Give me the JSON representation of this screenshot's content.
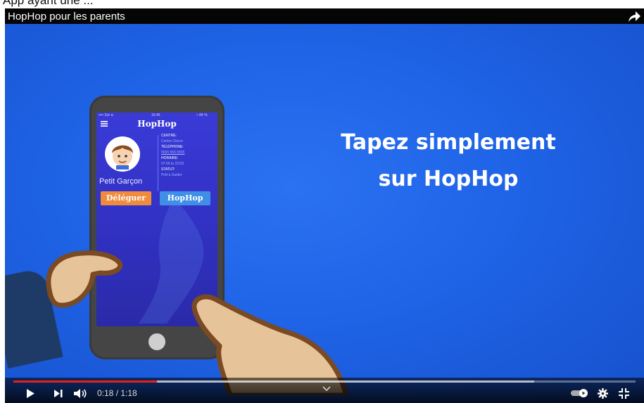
{
  "page": {
    "top_text": "App ayant une ..."
  },
  "player": {
    "title": "HopHop pour les parents",
    "colors": {
      "background": "#1f63e6",
      "progress": "#e62117",
      "title_bar": "#050505"
    }
  },
  "video": {
    "headline_line1": "Tapez simplement",
    "headline_line2": "sur HopHop",
    "phone": {
      "status_left": "•••• Sol ≋",
      "status_time": "15:45",
      "status_right": "≈ 84 %",
      "app_title": "HopHop",
      "centre_label": "CENTRE:",
      "centre_value": "Centre Clerco",
      "telephone_label": "TÉLÉPHONE:",
      "telephone_value": "5555 555 5555",
      "horaire_label": "HORAIRE:",
      "horaire_value": "07:00 to 23:59",
      "statut_label": "STATUT:",
      "statut_value": "Prêt à Guider",
      "child_name": "Petit Garçon",
      "deleguer_label": "Déléguer",
      "hophop_label": "HopHop"
    }
  },
  "controls": {
    "time_current": "0:18",
    "time_total": "1:18",
    "time_display": "0:18 / 1:18",
    "progress_fraction": 0.2308,
    "icons": [
      "play-icon",
      "next-icon",
      "volume-icon",
      "autoplay-toggle-icon",
      "settings-gear-icon",
      "exit-fullscreen-icon",
      "chevron-down-icon",
      "share-icon"
    ]
  }
}
